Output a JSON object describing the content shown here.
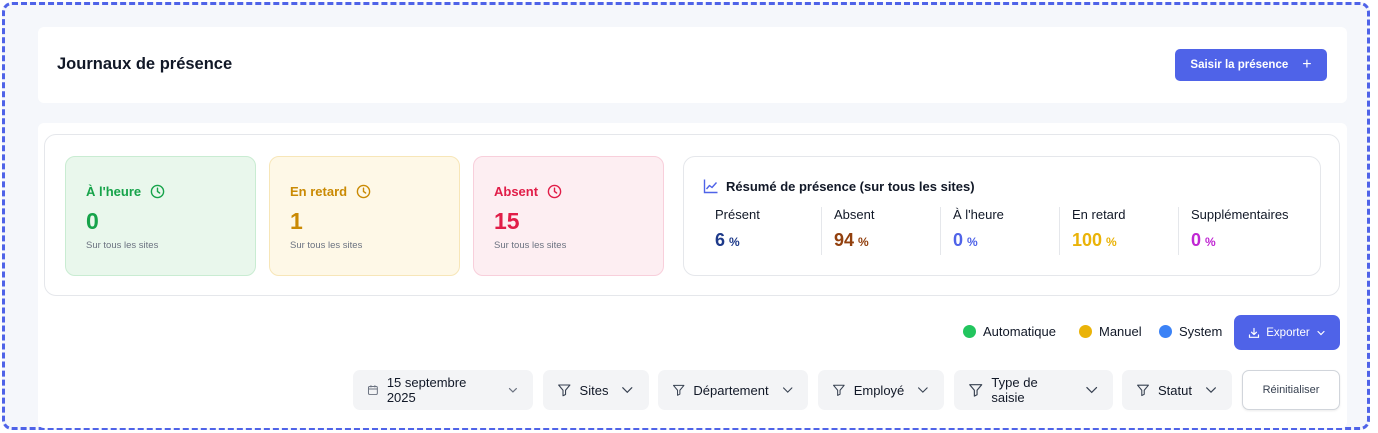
{
  "header": {
    "title": "Journaux de présence",
    "primary_button": "Saisir la présence",
    "primary_icon": "plus-icon"
  },
  "stats": [
    {
      "label": "À l'heure",
      "value": "0",
      "sub": "Sur tous les sites",
      "color": "#16a34a",
      "bg": "#e9f7ec",
      "border": "#c9ecd2"
    },
    {
      "label": "En retard",
      "value": "1",
      "sub": "Sur tous les sites",
      "color": "#ca8a04",
      "bg": "#fef8e7",
      "border": "#f7e6b8"
    },
    {
      "label": "Absent",
      "value": "15",
      "sub": "Sur tous les sites",
      "color": "#e11d48",
      "bg": "#fdeef2",
      "border": "#f8cfdb"
    }
  ],
  "summary": {
    "title": "Résumé de présence (sur tous les sites)",
    "metrics": [
      {
        "label": "Présent",
        "value": "6",
        "unit": "%",
        "color": "#1e3a8a"
      },
      {
        "label": "Absent",
        "value": "94",
        "unit": "%",
        "color": "#92400e"
      },
      {
        "label": "À l'heure",
        "value": "0",
        "unit": "%",
        "color": "#4f63e8"
      },
      {
        "label": "En retard",
        "value": "100",
        "unit": "%",
        "color": "#eab308"
      },
      {
        "label": "Supplémentaires",
        "value": "0",
        "unit": "%",
        "color": "#c026d3"
      }
    ]
  },
  "legend": [
    {
      "label": "Automatique",
      "color": "#22c55e"
    },
    {
      "label": "Manuel",
      "color": "#eab308"
    },
    {
      "label": "System",
      "color": "#3b82f6"
    }
  ],
  "export_button": "Exporter",
  "filters": {
    "date": "15 septembre 2025",
    "sites": "Sites",
    "department": "Département",
    "employee": "Employé",
    "entry_type": "Type de saisie",
    "status": "Statut"
  },
  "reset_button": "Réinitialiser",
  "colors": {
    "accent": "#4f63e8"
  }
}
